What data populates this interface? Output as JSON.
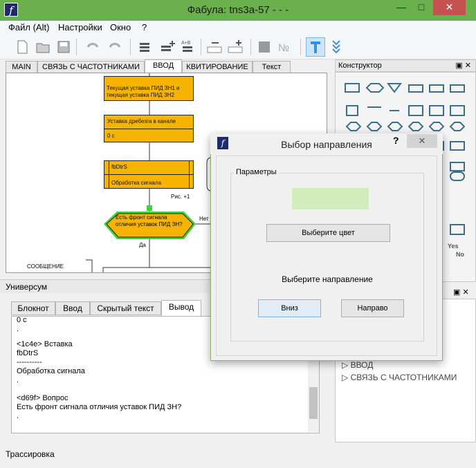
{
  "window": {
    "title": "Фабула: tns3a-57 - - -",
    "app_icon": "f"
  },
  "menu": [
    "Файл (Alt)",
    "Настройки",
    "Окно",
    "?"
  ],
  "tabs": [
    "MAIN",
    "СВЯЗЬ С ЧАСТОТНИКАМИ",
    "ВВОД",
    "КВИТИРОВАНИЕ",
    "Текст"
  ],
  "active_tab": "ВВОД",
  "flowchart": {
    "block1": "Текущая уставка ПИД ЗН1 и текущая уставка ПИД ЗН2",
    "block2_line1": "Уставка дребезга в канале",
    "block2_line2": "0 с",
    "block3_line1": "fbDtrS",
    "block3_line2": "Обработка сигнала",
    "fig_label": "Рис. +1",
    "decision": "Есть фронт сигнала отличия уставок ПИД ЗН?",
    "no_label": "Нет",
    "yes_label": "Да",
    "message_label": "СООБЩЕНИЕ",
    "colors": {
      "block": "#f6b400",
      "selection": "#3ed43e"
    }
  },
  "konstructor": {
    "title": "Конструктор",
    "yes": "Yes",
    "no": "No"
  },
  "universum": {
    "title": "Универсум",
    "tabs": [
      "Блокнот",
      "Ввод",
      "Скрытый текст",
      "Вывод"
    ],
    "active_tab": "Вывод",
    "output_lines": [
      "0 с",
      ".",
      "",
      "<1c4e>  Вставка",
      "fbDtrS",
      "----------",
      "Обработка сигнала",
      ".",
      "",
      "<d69f>  Вопрос",
      "Есть фронт сигнала отличия уставок ПИД ЗН?",
      "."
    ]
  },
  "tree": [
    "ВВОД",
    "СВЯЗЬ С ЧАСТОТНИКАМИ"
  ],
  "status": "Трассировка",
  "dialog": {
    "title": "Выбор направления",
    "help": "?",
    "close": "✕",
    "group": "Параметры",
    "color_button": "Выберите цвет",
    "prompt": "Выберите направление",
    "down": "Вниз",
    "right": "Направо",
    "swatch_color": "#d2ecbc"
  }
}
